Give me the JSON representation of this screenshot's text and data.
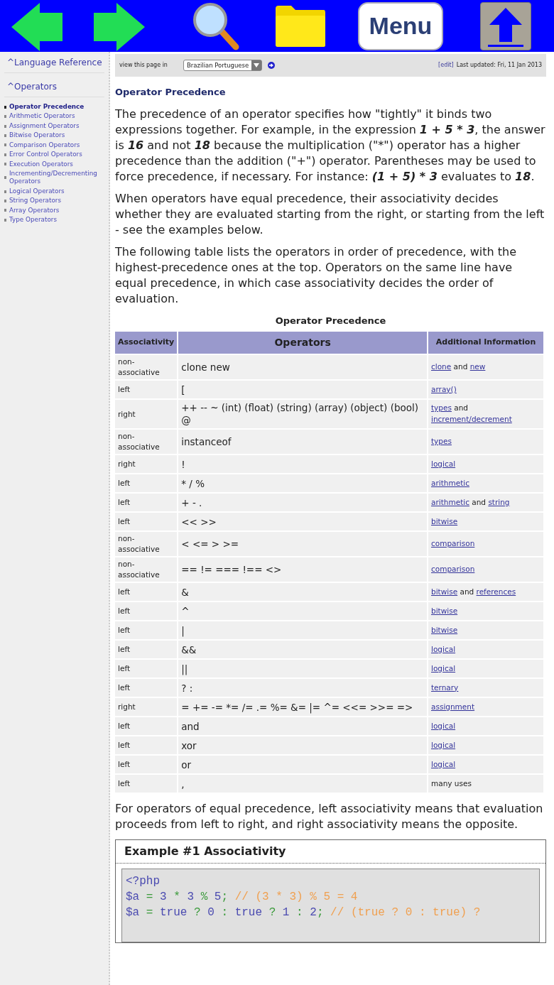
{
  "toolbar": {
    "buttons": [
      {
        "kind": "back"
      },
      {
        "kind": "forward"
      },
      {
        "kind": "search"
      },
      {
        "kind": "folder"
      },
      {
        "kind": "menu",
        "label": "Menu"
      },
      {
        "kind": "top"
      }
    ]
  },
  "sidebar": {
    "sections": [
      {
        "label": "^Language Reference"
      },
      {
        "label": "^Operators",
        "items": [
          {
            "label": "Operator Precedence",
            "selected": true
          },
          {
            "label": "Arithmetic Operators",
            "selected": false
          },
          {
            "label": "Assignment Operators",
            "selected": false
          },
          {
            "label": "Bitwise Operators",
            "selected": false
          },
          {
            "label": "Comparison Operators",
            "selected": false
          },
          {
            "label": "Error Control Operators",
            "selected": false
          },
          {
            "label": "Execution Operators",
            "selected": false
          },
          {
            "label": "Incrementing/Decrementing Operators",
            "selected": false
          },
          {
            "label": "Logical Operators",
            "selected": false
          },
          {
            "label": "String Operators",
            "selected": false
          },
          {
            "label": "Array Operators",
            "selected": false
          },
          {
            "label": "Type Operators",
            "selected": false
          }
        ]
      }
    ]
  },
  "language_bar": {
    "label": "view this page in",
    "language": "Brazilian Portuguese",
    "edit_link": "[edit]",
    "last_updated": "Last updated: Fri, 11 Jan 2013"
  },
  "heading": "Operator Precedence",
  "intro": [
    {
      "runs": [
        {
          "text": "The precedence of an operator specifies how \"tightly\" it binds two expressions together. For example, in the expression ",
          "em": false
        },
        {
          "text": "1 + 5 * 3",
          "em": true
        },
        {
          "text": ", the answer is ",
          "em": false
        },
        {
          "text": "16",
          "em": true
        },
        {
          "text": " and not ",
          "em": false
        },
        {
          "text": "18",
          "em": true
        },
        {
          "text": " because the multiplication (\"*\") operator has a higher precedence than the addition (\"+\") operator. Parentheses may be used to force precedence, if necessary. For instance: ",
          "em": false
        },
        {
          "text": "(1 + 5) * 3",
          "em": true
        },
        {
          "text": " evaluates to ",
          "em": false
        },
        {
          "text": "18",
          "em": true
        },
        {
          "text": ".",
          "em": false
        }
      ]
    },
    {
      "runs": [
        {
          "text": "When operators have equal precedence, their associativity decides whether they are evaluated starting from the right, or starting from the left - see the examples below.",
          "em": false
        }
      ]
    },
    {
      "runs": [
        {
          "text": "The following table lists the operators in order of precedence, with the highest-precedence ones at the top. Operators on the same line have equal precedence, in which case associativity decides the order of evaluation.",
          "em": false
        }
      ]
    }
  ],
  "table": {
    "caption": "Operator Precedence",
    "columns": [
      "Associativity",
      "Operators",
      "Additional Information"
    ],
    "rows": [
      {
        "associativity": "non-associative",
        "operators": "clone new",
        "info": [
          {
            "text": "clone",
            "link": true
          },
          {
            "text": " and ",
            "link": false
          },
          {
            "text": "new",
            "link": true
          }
        ]
      },
      {
        "associativity": "left",
        "operators": "[",
        "info": [
          {
            "text": "array()",
            "link": true
          }
        ]
      },
      {
        "associativity": "right",
        "operators": "++ -- ~ (int) (float) (string) (array) (object) (bool) @",
        "info": [
          {
            "text": "types",
            "link": true
          },
          {
            "text": " and ",
            "link": false
          },
          {
            "text": "increment/decrement",
            "link": true
          }
        ]
      },
      {
        "associativity": "non-associative",
        "operators": "instanceof",
        "info": [
          {
            "text": "types",
            "link": true
          }
        ]
      },
      {
        "associativity": "right",
        "operators": "!",
        "info": [
          {
            "text": "logical",
            "link": true
          }
        ]
      },
      {
        "associativity": "left",
        "operators": "* / %",
        "info": [
          {
            "text": "arithmetic",
            "link": true
          }
        ]
      },
      {
        "associativity": "left",
        "operators": "+ - .",
        "info": [
          {
            "text": "arithmetic",
            "link": true
          },
          {
            "text": " and ",
            "link": false
          },
          {
            "text": "string",
            "link": true
          }
        ]
      },
      {
        "associativity": "left",
        "operators": "<< >>",
        "info": [
          {
            "text": "bitwise",
            "link": true
          }
        ]
      },
      {
        "associativity": "non-associative",
        "operators": "< <= > >=",
        "info": [
          {
            "text": "comparison",
            "link": true
          }
        ]
      },
      {
        "associativity": "non-associative",
        "operators": "== != === !== <>",
        "info": [
          {
            "text": "comparison",
            "link": true
          }
        ]
      },
      {
        "associativity": "left",
        "operators": "&",
        "info": [
          {
            "text": "bitwise",
            "link": true
          },
          {
            "text": " and ",
            "link": false
          },
          {
            "text": "references",
            "link": true
          }
        ]
      },
      {
        "associativity": "left",
        "operators": "^",
        "info": [
          {
            "text": "bitwise",
            "link": true
          }
        ]
      },
      {
        "associativity": "left",
        "operators": "|",
        "info": [
          {
            "text": "bitwise",
            "link": true
          }
        ]
      },
      {
        "associativity": "left",
        "operators": "&&",
        "info": [
          {
            "text": "logical",
            "link": true
          }
        ]
      },
      {
        "associativity": "left",
        "operators": "||",
        "info": [
          {
            "text": "logical",
            "link": true
          }
        ]
      },
      {
        "associativity": "left",
        "operators": "? :",
        "info": [
          {
            "text": "ternary",
            "link": true
          }
        ]
      },
      {
        "associativity": "right",
        "operators": "= += -= *= /= .= %= &= |= ^= <<= >>= =>",
        "info": [
          {
            "text": "assignment",
            "link": true
          }
        ]
      },
      {
        "associativity": "left",
        "operators": "and",
        "info": [
          {
            "text": "logical",
            "link": true
          }
        ]
      },
      {
        "associativity": "left",
        "operators": "xor",
        "info": [
          {
            "text": "logical",
            "link": true
          }
        ]
      },
      {
        "associativity": "left",
        "operators": "or",
        "info": [
          {
            "text": "logical",
            "link": true
          }
        ]
      },
      {
        "associativity": "left",
        "operators": ",",
        "info": [
          {
            "text": "many uses",
            "link": false
          }
        ]
      }
    ]
  },
  "outro": "For operators of equal precedence, left associativity means that evaluation proceeds from left to right, and right associativity means the opposite.",
  "example": {
    "title": "Example #1 Associativity",
    "lines": [
      [
        {
          "text": "<?php",
          "kind": "default"
        }
      ],
      [
        {
          "text": "$a ",
          "kind": "default"
        },
        {
          "text": "= ",
          "kind": "keyword"
        },
        {
          "text": "3 ",
          "kind": "default"
        },
        {
          "text": "* ",
          "kind": "keyword"
        },
        {
          "text": "3 ",
          "kind": "default"
        },
        {
          "text": "% ",
          "kind": "keyword"
        },
        {
          "text": "5",
          "kind": "default"
        },
        {
          "text": "; ",
          "kind": "keyword"
        },
        {
          "text": "// (3 * 3) % 5 = 4",
          "kind": "comment"
        }
      ],
      [
        {
          "text": "$a ",
          "kind": "default"
        },
        {
          "text": "= ",
          "kind": "keyword"
        },
        {
          "text": "true ",
          "kind": "default"
        },
        {
          "text": "? ",
          "kind": "keyword"
        },
        {
          "text": "0 ",
          "kind": "default"
        },
        {
          "text": ": ",
          "kind": "keyword"
        },
        {
          "text": "true ",
          "kind": "default"
        },
        {
          "text": "? ",
          "kind": "keyword"
        },
        {
          "text": "1 ",
          "kind": "default"
        },
        {
          "text": ": ",
          "kind": "keyword"
        },
        {
          "text": "2",
          "kind": "default"
        },
        {
          "text": "; ",
          "kind": "keyword"
        },
        {
          "text": "// (true ? 0 : true) ?",
          "kind": "comment"
        }
      ]
    ]
  }
}
